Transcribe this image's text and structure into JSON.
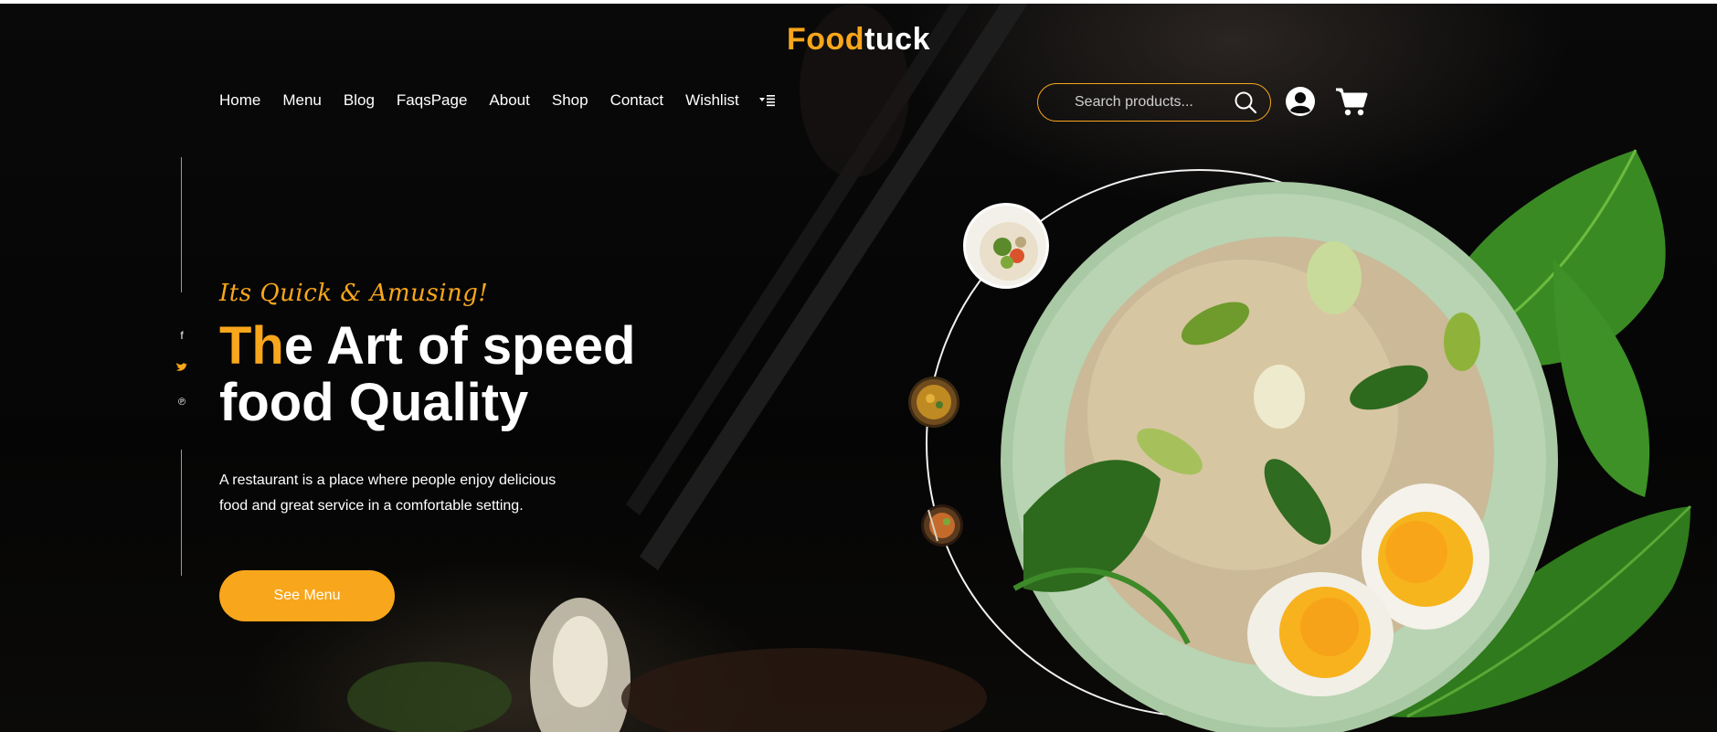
{
  "brand": {
    "name_accent": "Food",
    "name_rest": "tuck",
    "accent_color": "#f8a61b"
  },
  "nav": {
    "items": [
      {
        "label": "Home"
      },
      {
        "label": "Menu"
      },
      {
        "label": "Blog"
      },
      {
        "label": "FaqsPage"
      },
      {
        "label": "About"
      },
      {
        "label": "Shop"
      },
      {
        "label": "Contact"
      },
      {
        "label": "Wishlist"
      }
    ],
    "more_icon": "dropdown-menu-icon"
  },
  "search": {
    "placeholder": "Search products..."
  },
  "header_icons": [
    "search-icon",
    "user-account-icon",
    "shopping-cart-icon"
  ],
  "social": [
    {
      "icon": "facebook-icon",
      "glyph": "f"
    },
    {
      "icon": "twitter-icon",
      "glyph": "🐦"
    },
    {
      "icon": "pinterest-icon",
      "glyph": "℗"
    }
  ],
  "hero": {
    "tagline": "Its Quick & Amusing!",
    "headline_accent": "Th",
    "headline_line1_rest": "e Art of speed",
    "headline_line2": "food Quality",
    "description": "A restaurant is a place where people enjoy delicious food and great service in a comfortable setting.",
    "cta_label": "See Menu"
  },
  "dishes": [
    "salad-thumbnail",
    "curry-bowl-thumbnail",
    "noodle-thumbnail",
    "rice-bowl-main-image"
  ]
}
